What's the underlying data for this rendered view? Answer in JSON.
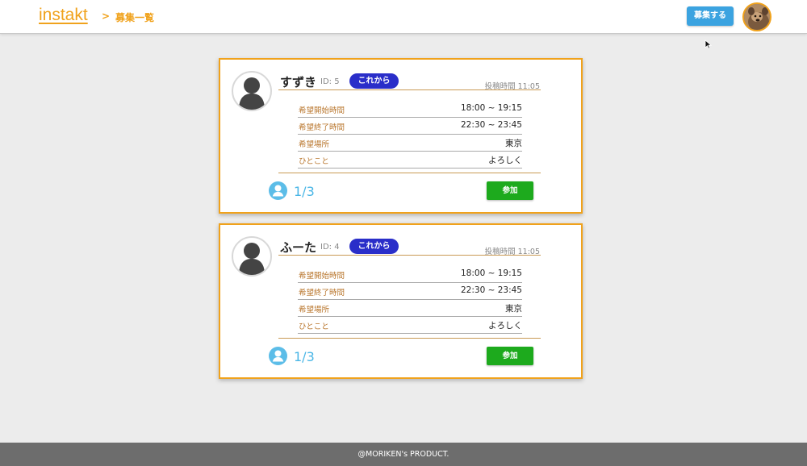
{
  "header": {
    "brand": "instakt",
    "breadcrumb_separator": ">",
    "breadcrumb_page": "募集一覧",
    "recruit_button": "募集する",
    "avatar_icon": "user-photo-avatar"
  },
  "posts": [
    {
      "name": "すずき",
      "id_label": "ID: 5",
      "status": "これから",
      "posted": "投稿時間 11:05",
      "rows": [
        {
          "label": "希望開始時間",
          "value": "18:00 ~ 19:15"
        },
        {
          "label": "希望終了時間",
          "value": "22:30 ~ 23:45"
        },
        {
          "label": "希望場所",
          "value": "東京"
        },
        {
          "label": "ひとこと",
          "value": "よろしく"
        }
      ],
      "members": "1/3",
      "join_label": "参加"
    },
    {
      "name": "ふーた",
      "id_label": "ID: 4",
      "status": "これから",
      "posted": "投稿時間 11:05",
      "rows": [
        {
          "label": "希望開始時間",
          "value": "18:00 ~ 19:15"
        },
        {
          "label": "希望終了時間",
          "value": "22:30 ~ 23:45"
        },
        {
          "label": "希望場所",
          "value": "東京"
        },
        {
          "label": "ひとこと",
          "value": "よろしく"
        }
      ],
      "members": "1/3",
      "join_label": "参加"
    }
  ],
  "footer": {
    "text": "@MORIKEN's PRODUCT."
  },
  "colors": {
    "accent": "#f0a21c",
    "recruit_button": "#3ba3e0",
    "status_badge": "#2a2ec9",
    "join_button": "#1daa1d",
    "member_count": "#4ab6e6",
    "footer": "#6d6d6d"
  }
}
